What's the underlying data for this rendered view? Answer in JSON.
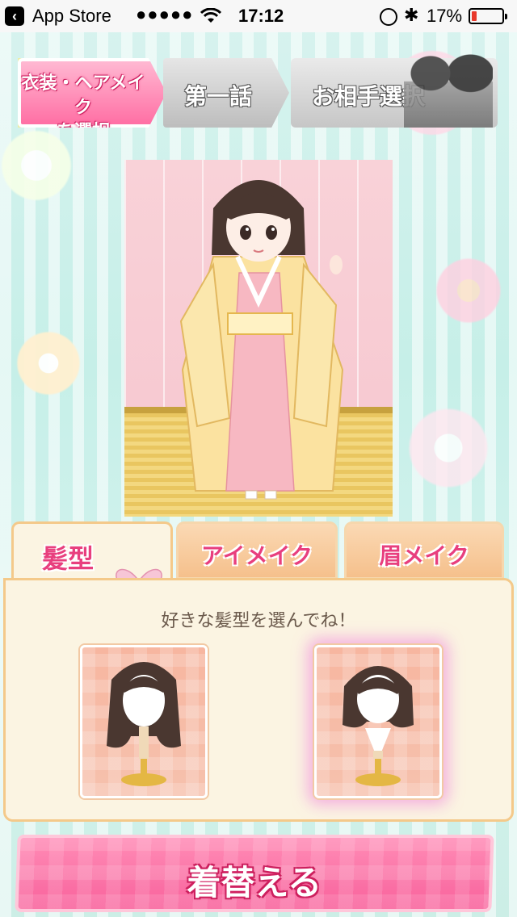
{
  "status_bar": {
    "back_app": "App Store",
    "signal": "●●●●●",
    "time": "17:12",
    "bluetooth": "✱",
    "battery_percent": "17%",
    "battery_level": 0.17
  },
  "top_tabs": {
    "costume_line1": "衣装・ヘアメイク",
    "costume_line2": "を選択",
    "story": "第一話",
    "partner": "お相手選択"
  },
  "sub_tabs": {
    "hair": "髪型",
    "eye": "アイメイク",
    "brow": "眉メイク"
  },
  "panel": {
    "message": "好きな髪型を選んでね！"
  },
  "hair_options": [
    {
      "style": "long-hair"
    },
    {
      "style": "bob-hair",
      "selected": true
    }
  ],
  "change_button": "着替える",
  "colors": {
    "accent_pink": "#f8629c",
    "tab_label_pink": "#e83f7e",
    "panel_bg": "#fbf4e2",
    "background_mint": "#d3f3ee"
  }
}
